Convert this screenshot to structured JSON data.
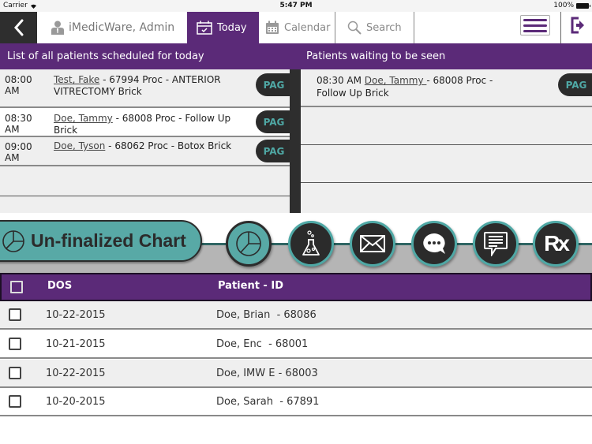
{
  "status_bar": {
    "carrier": "Carrier",
    "time": "5:47 PM",
    "battery": "100%"
  },
  "nav": {
    "user_label": "iMedicWare, Admin",
    "tabs": [
      {
        "label": "Today",
        "icon": "calendar-check-icon",
        "active": true
      },
      {
        "label": "Calendar",
        "icon": "calendar-grid-icon",
        "active": false
      },
      {
        "label": "Search",
        "icon": "search-icon",
        "active": false
      }
    ]
  },
  "scheduled": {
    "title": "List of all patients scheduled for today",
    "rows": [
      {
        "time": "08:00 AM",
        "name": "Test, Fake",
        "rest": " - 67994  Proc - ANTERIOR VITRECTOMY  Brick",
        "action": "PAG"
      },
      {
        "time": "08:30 AM",
        "name": "Doe, Tammy",
        "rest": " - 68008  Proc - Follow Up  Brick",
        "action": "PAG"
      },
      {
        "time": "09:00 AM",
        "name": "Doe, Tyson",
        "rest": " - 68062  Proc - Botox  Brick",
        "action": "PAG"
      }
    ]
  },
  "waiting": {
    "title": "Patients waiting to be seen",
    "rows": [
      {
        "time": "08:30 AM",
        "name": "Doe, Tammy ",
        "rest": "- 68008  Proc - Follow Up  Brick",
        "action": "PAG"
      }
    ]
  },
  "toolbar": {
    "active_label": "Un-finalized Chart",
    "buttons": [
      "chart",
      "lab",
      "mail",
      "chat",
      "message",
      "rx"
    ],
    "rx_text": "Rx"
  },
  "table": {
    "columns": [
      "DOS",
      "Patient - ID"
    ],
    "rows": [
      {
        "dos": "10-22-2015",
        "patient": "Doe, Brian  - 68086",
        "checked": false
      },
      {
        "dos": "10-21-2015",
        "patient": "Doe, Enc  - 68001",
        "checked": false
      },
      {
        "dos": "10-22-2015",
        "patient": "Doe, IMW E - 68003",
        "checked": false
      },
      {
        "dos": "10-20-2015",
        "patient": "Doe, Sarah  - 67891",
        "checked": false
      }
    ]
  },
  "colors": {
    "brand_purple": "#5b2a78",
    "teal": "#58a9a6",
    "dark": "#2b2b2b"
  }
}
